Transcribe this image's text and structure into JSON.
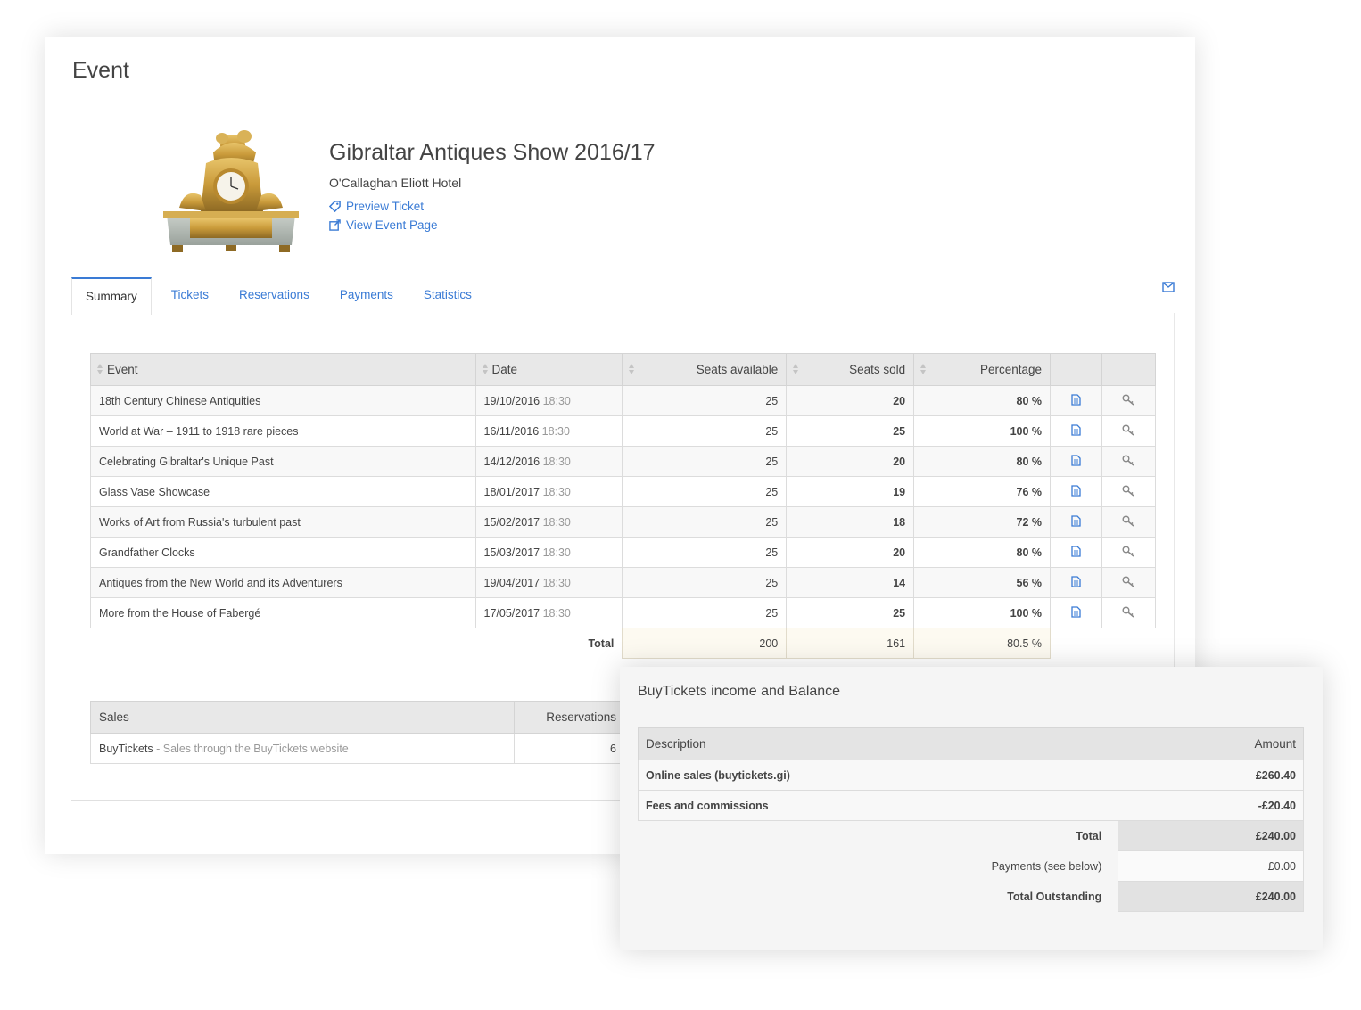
{
  "page": {
    "title": "Event"
  },
  "event": {
    "name": "Gibraltar Antiques Show 2016/17",
    "venue": "O'Callaghan Eliott Hotel",
    "preview_ticket": "Preview Ticket",
    "view_event_page": "View Event Page"
  },
  "tabs": [
    {
      "label": "Summary",
      "active": true
    },
    {
      "label": "Tickets"
    },
    {
      "label": "Reservations"
    },
    {
      "label": "Payments"
    },
    {
      "label": "Statistics"
    }
  ],
  "events_table": {
    "headers": [
      "Event",
      "Date",
      "Seats available",
      "Seats sold",
      "Percentage"
    ],
    "rows": [
      {
        "event": "18th Century Chinese Antiquities",
        "date": "19/10/2016",
        "time": "18:30",
        "available": "25",
        "sold": "20",
        "pct": "80 %"
      },
      {
        "event": "World at War – 1911 to 1918 rare pieces",
        "date": "16/11/2016",
        "time": "18:30",
        "available": "25",
        "sold": "25",
        "pct": "100 %"
      },
      {
        "event": "Celebrating Gibraltar's Unique Past",
        "date": "14/12/2016",
        "time": "18:30",
        "available": "25",
        "sold": "20",
        "pct": "80 %"
      },
      {
        "event": "Glass Vase Showcase",
        "date": "18/01/2017",
        "time": "18:30",
        "available": "25",
        "sold": "19",
        "pct": "76 %"
      },
      {
        "event": "Works of Art from Russia's turbulent past",
        "date": "15/02/2017",
        "time": "18:30",
        "available": "25",
        "sold": "18",
        "pct": "72 %"
      },
      {
        "event": "Grandfather Clocks",
        "date": "15/03/2017",
        "time": "18:30",
        "available": "25",
        "sold": "20",
        "pct": "80 %"
      },
      {
        "event": "Antiques from the New World and its Adventurers",
        "date": "19/04/2017",
        "time": "18:30",
        "available": "25",
        "sold": "14",
        "pct": "56 %"
      },
      {
        "event": "More from the House of Fabergé",
        "date": "17/05/2017",
        "time": "18:30",
        "available": "25",
        "sold": "25",
        "pct": "100 %"
      }
    ],
    "total": {
      "label": "Total",
      "available": "200",
      "sold": "161",
      "pct": "80.5 %"
    }
  },
  "sales_table": {
    "headers": [
      "Sales",
      "Reservations"
    ],
    "rows": [
      {
        "name": "BuyTickets",
        "desc": " - Sales through the BuyTickets website",
        "reservations": "6"
      }
    ]
  },
  "balance": {
    "title": "BuyTickets income and Balance",
    "headers": [
      "Description",
      "Amount"
    ],
    "rows": [
      {
        "desc": "Online sales (buytickets.gi)",
        "amount": "£260.40"
      },
      {
        "desc": "Fees and commissions",
        "amount": "-£20.40"
      }
    ],
    "total": {
      "label": "Total",
      "amount": "£240.00"
    },
    "payments": {
      "label": "Payments (see below)",
      "amount": "£0.00"
    },
    "outstanding": {
      "label": "Total Outstanding",
      "amount": "£240.00"
    }
  },
  "colors": {
    "link": "#3a7bd5",
    "header_bg": "#e8e8e8",
    "total_bg": "#fdfaf1"
  },
  "icons": {
    "preview": "tag-icon",
    "view": "external-link-icon",
    "row_doc": "document-icon",
    "row_key": "key-icon",
    "mail": "envelope-icon"
  }
}
